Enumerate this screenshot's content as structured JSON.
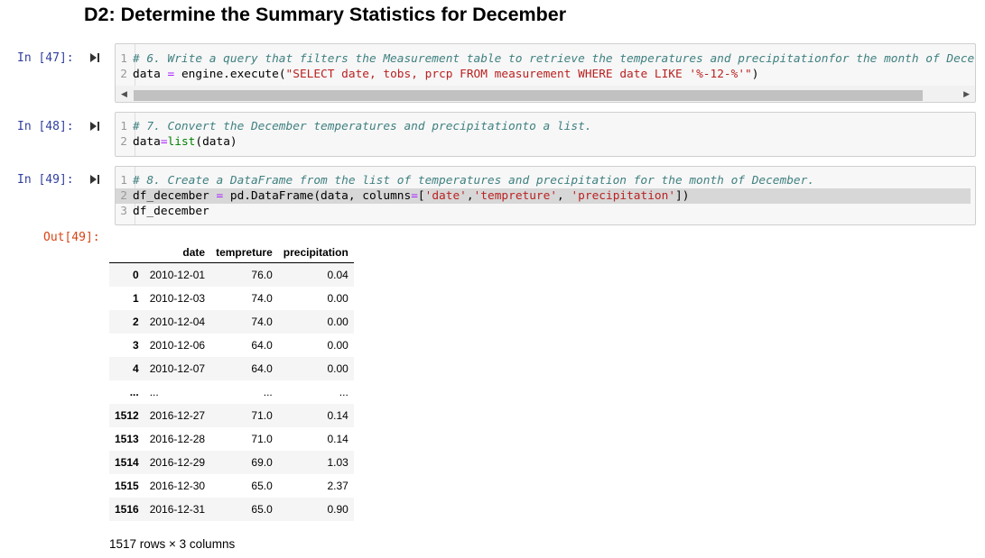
{
  "heading": "D2: Determine the Summary Statistics for December",
  "cells": [
    {
      "prompt": "In [47]:",
      "lines": [
        {
          "num": "1",
          "parts": [
            {
              "t": "# 6. Write a query that filters the Measurement table to retrieve the temperatures and precipitationfor the month of Dece",
              "c": "cm"
            }
          ]
        },
        {
          "num": "2",
          "parts": [
            {
              "t": "data ",
              "c": "nm"
            },
            {
              "t": "=",
              "c": "op"
            },
            {
              "t": " engine.execute(",
              "c": "nm"
            },
            {
              "t": "\"SELECT date, tobs, prcp FROM measurement WHERE date LIKE '%-12-%'\"",
              "c": "st"
            },
            {
              "t": ")",
              "c": "nm"
            }
          ]
        }
      ]
    },
    {
      "prompt": "In [48]:",
      "lines": [
        {
          "num": "1",
          "parts": [
            {
              "t": "# 7. Convert the December temperatures and precipitationto a list.",
              "c": "cm"
            }
          ]
        },
        {
          "num": "2",
          "parts": [
            {
              "t": "data",
              "c": "nm"
            },
            {
              "t": "=",
              "c": "op"
            },
            {
              "t": "list",
              "c": "kw"
            },
            {
              "t": "(data)",
              "c": "nm"
            }
          ]
        }
      ]
    },
    {
      "prompt": "In [49]:",
      "lines": [
        {
          "num": "1",
          "parts": [
            {
              "t": "# 8. Create a DataFrame from the list of temperatures and precipitation for the month of December.",
              "c": "cm"
            }
          ]
        },
        {
          "num": "2",
          "parts": [
            {
              "t": "df_december ",
              "c": "nm"
            },
            {
              "t": "=",
              "c": "op"
            },
            {
              "t": " pd.DataFrame(data, columns",
              "c": "nm"
            },
            {
              "t": "=",
              "c": "op"
            },
            {
              "t": "[",
              "c": "nm"
            },
            {
              "t": "'date'",
              "c": "st"
            },
            {
              "t": ",",
              "c": "nm"
            },
            {
              "t": "'tempreture'",
              "c": "st"
            },
            {
              "t": ", ",
              "c": "nm"
            },
            {
              "t": "'precipitation'",
              "c": "st"
            },
            {
              "t": "])",
              "c": "nm"
            }
          ]
        },
        {
          "num": "3",
          "parts": [
            {
              "t": "df_december",
              "c": "nm"
            }
          ]
        }
      ]
    }
  ],
  "output": {
    "prompt": "Out[49]:",
    "columns": [
      "date",
      "tempreture",
      "precipitation"
    ],
    "rows": [
      {
        "index": "0",
        "date": "2010-12-01",
        "temp": "76.0",
        "prcp": "0.04"
      },
      {
        "index": "1",
        "date": "2010-12-03",
        "temp": "74.0",
        "prcp": "0.00"
      },
      {
        "index": "2",
        "date": "2010-12-04",
        "temp": "74.0",
        "prcp": "0.00"
      },
      {
        "index": "3",
        "date": "2010-12-06",
        "temp": "64.0",
        "prcp": "0.00"
      },
      {
        "index": "4",
        "date": "2010-12-07",
        "temp": "64.0",
        "prcp": "0.00"
      },
      {
        "index": "...",
        "date": "...",
        "temp": "...",
        "prcp": "..."
      },
      {
        "index": "1512",
        "date": "2016-12-27",
        "temp": "71.0",
        "prcp": "0.14"
      },
      {
        "index": "1513",
        "date": "2016-12-28",
        "temp": "71.0",
        "prcp": "0.14"
      },
      {
        "index": "1514",
        "date": "2016-12-29",
        "temp": "69.0",
        "prcp": "1.03"
      },
      {
        "index": "1515",
        "date": "2016-12-30",
        "temp": "65.0",
        "prcp": "2.37"
      },
      {
        "index": "1516",
        "date": "2016-12-31",
        "temp": "65.0",
        "prcp": "0.90"
      }
    ],
    "shape": "1517 rows × 3 columns"
  }
}
